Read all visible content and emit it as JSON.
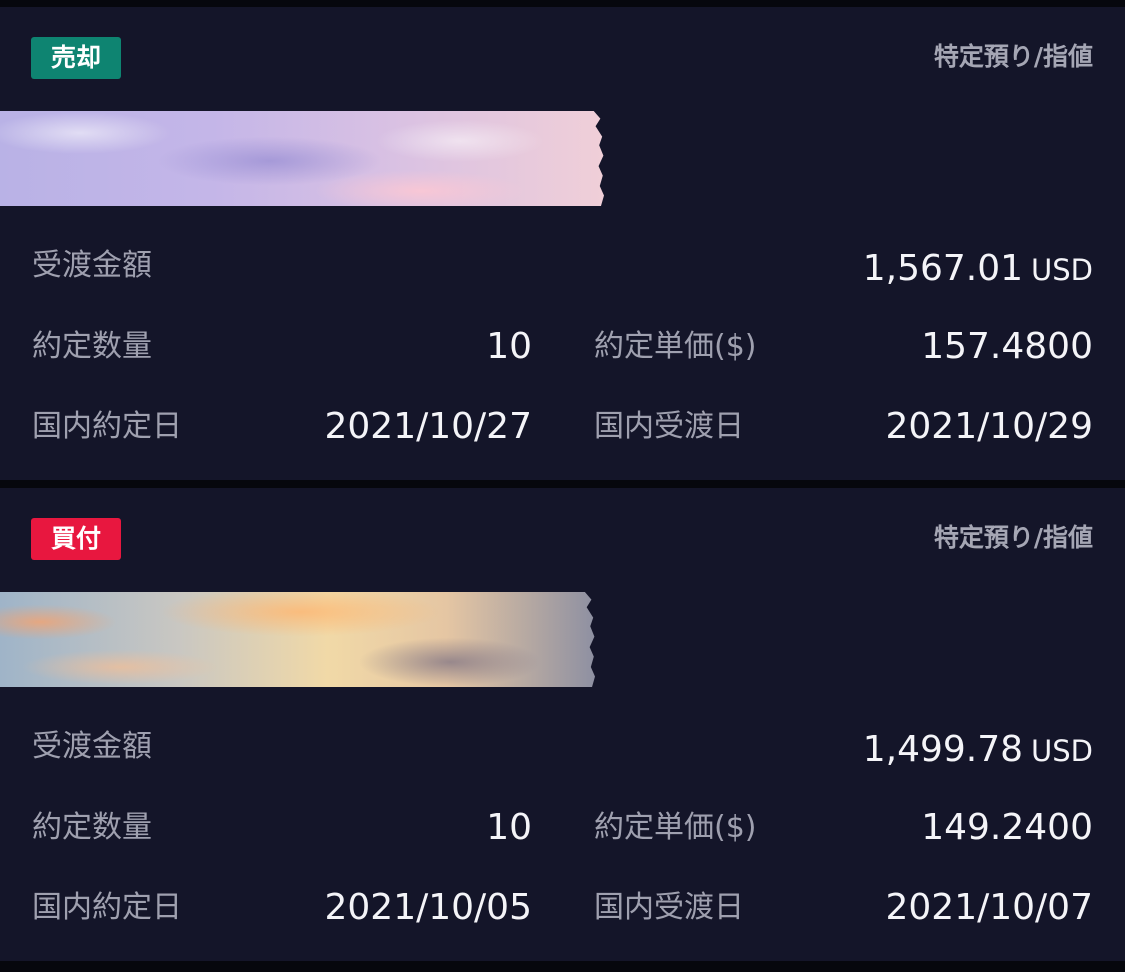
{
  "colors": {
    "sell_badge": "#0e8471",
    "buy_badge": "#e8173f",
    "card_bg": "#141529",
    "page_bg": "#06070d"
  },
  "labels": {
    "settlement_amount": "受渡金額",
    "quantity": "約定数量",
    "unit_price": "約定単価($)",
    "trade_date": "国内約定日",
    "settlement_date": "国内受渡日"
  },
  "trades": [
    {
      "side": "売却",
      "account": "特定預り/指値",
      "amount": "1,567.01",
      "currency": "USD",
      "quantity": "10",
      "unit_price": "157.4800",
      "trade_date": "2021/10/27",
      "settlement_date": "2021/10/29"
    },
    {
      "side": "買付",
      "account": "特定預り/指値",
      "amount": "1,499.78",
      "currency": "USD",
      "quantity": "10",
      "unit_price": "149.2400",
      "trade_date": "2021/10/05",
      "settlement_date": "2021/10/07"
    }
  ]
}
